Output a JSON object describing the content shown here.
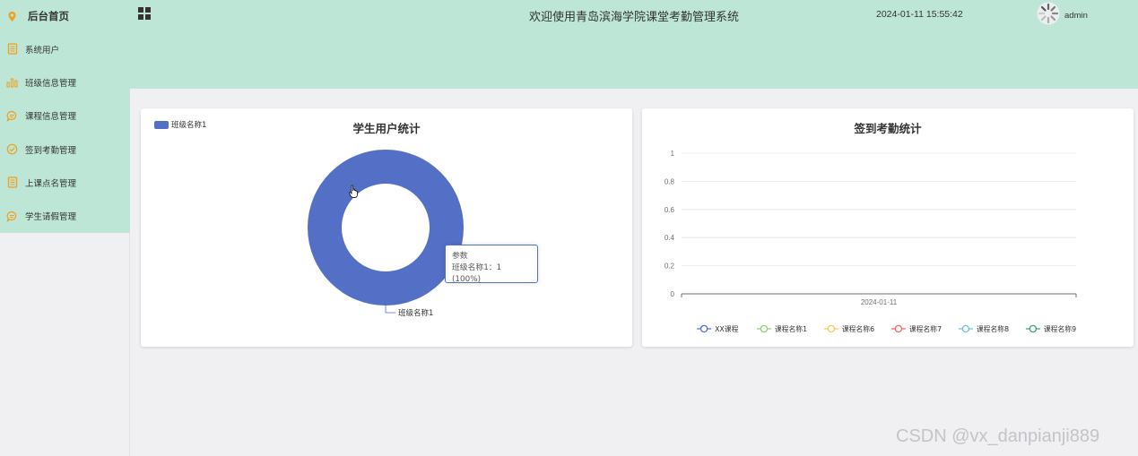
{
  "sidebar": {
    "items": [
      {
        "label": "后台首页",
        "icon": "location-pin-icon"
      },
      {
        "label": "系统用户",
        "icon": "document-icon"
      },
      {
        "label": "班级信息管理",
        "icon": "bar-chart-icon"
      },
      {
        "label": "课程信息管理",
        "icon": "chat-bubble-icon"
      },
      {
        "label": "签到考勤管理",
        "icon": "check-circle-icon"
      },
      {
        "label": "上课点名管理",
        "icon": "document-icon"
      },
      {
        "label": "学生请假管理",
        "icon": "chat-bubble-icon"
      }
    ]
  },
  "header": {
    "title": "欢迎使用青岛滨海学院课堂考勤管理系统",
    "datetime": "2024-01-11 15:55:42",
    "username": "admin"
  },
  "left_card": {
    "title": "学生用户统计",
    "legend": "班级名称1",
    "label": "班级名称1",
    "tooltip_title": "参数",
    "tooltip_value": "班级名称1：1 (100%)"
  },
  "right_card": {
    "title": "签到考勤统计"
  },
  "watermark": "CSDN @vx_danpianji889",
  "colors": {
    "sidebar_bg": "#bde6d6",
    "accent_orange": "#f0a020",
    "pie_blue": "#5470c6"
  },
  "chart_data": [
    {
      "type": "pie",
      "title": "学生用户统计",
      "donut": true,
      "slices": [
        {
          "name": "班级名称1",
          "value": 1,
          "percent": 100
        }
      ],
      "legend_position": "top-left"
    },
    {
      "type": "line",
      "title": "签到考勤统计",
      "x": [
        "2024-01-11"
      ],
      "ylim": [
        0,
        1
      ],
      "yticks": [
        "1",
        "0.8",
        "0.6",
        "0.4",
        "0.2",
        "0"
      ],
      "grid": true,
      "legend_position": "bottom",
      "series": [
        {
          "name": "XX课程",
          "values": [
            0
          ],
          "color": "#5470c6"
        },
        {
          "name": "课程名称1",
          "values": [
            0
          ],
          "color": "#91cc75"
        },
        {
          "name": "课程名称6",
          "values": [
            0
          ],
          "color": "#fac858"
        },
        {
          "name": "课程名称7",
          "values": [
            0
          ],
          "color": "#ee6666"
        },
        {
          "name": "课程名称8",
          "values": [
            0
          ],
          "color": "#73c0de"
        },
        {
          "name": "课程名称9",
          "values": [
            0
          ],
          "color": "#3ba272"
        }
      ]
    }
  ]
}
